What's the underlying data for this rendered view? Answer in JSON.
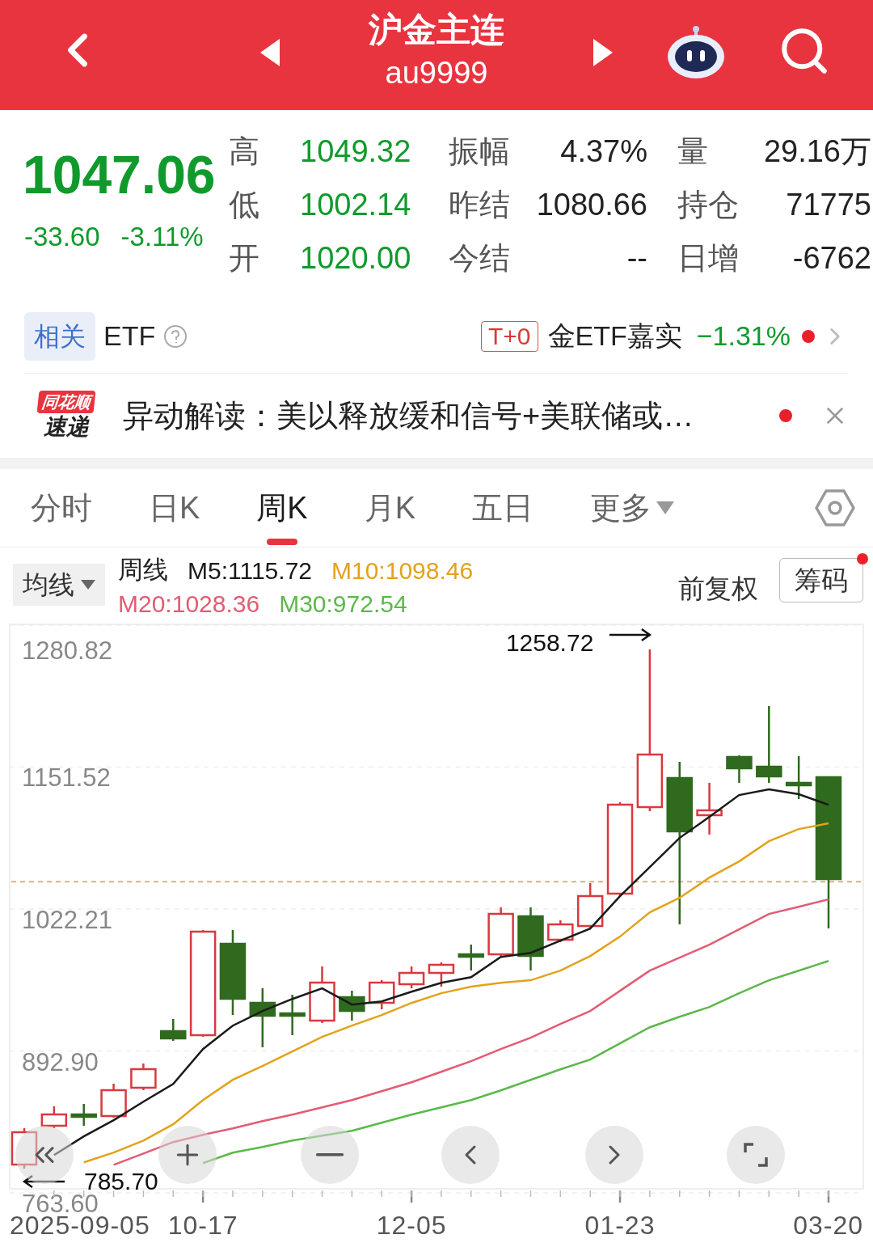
{
  "header": {
    "title": "沪金主连",
    "code": "au9999"
  },
  "quote": {
    "price": "1047.06",
    "change": "-33.60",
    "change_pct": "-3.11%",
    "color": "#109a2c",
    "stats": [
      {
        "label": "高",
        "value": "1049.32",
        "color": "#109a2c"
      },
      {
        "label": "振幅",
        "value": "4.37%",
        "color": "#222222"
      },
      {
        "label": "量",
        "value": "29.16万",
        "color": "#222222"
      },
      {
        "label": "低",
        "value": "1002.14",
        "color": "#109a2c"
      },
      {
        "label": "昨结",
        "value": "1080.66",
        "color": "#222222"
      },
      {
        "label": "持仓",
        "value": "71775",
        "color": "#222222"
      },
      {
        "label": "开",
        "value": "1020.00",
        "color": "#109a2c"
      },
      {
        "label": "今结",
        "value": "--",
        "color": "#222222"
      },
      {
        "label": "日增",
        "value": "-6762",
        "color": "#222222"
      }
    ]
  },
  "etf": {
    "tag": "相关",
    "label": "ETF",
    "badge": "T+0",
    "fund": "金ETF嘉实",
    "change": "−1.31%",
    "color": "#109a2c",
    "unread": true
  },
  "news": {
    "logo_top": "同花顺",
    "logo_bottom": "速递",
    "text": "异动解读：美以释放缓和信号+美联储或…",
    "unread": true
  },
  "period_tabs": [
    {
      "label": "分时",
      "selected": false,
      "kind": "tab"
    },
    {
      "label": "日K",
      "selected": false,
      "kind": "tab"
    },
    {
      "label": "周K",
      "selected": true,
      "kind": "tab"
    },
    {
      "label": "月K",
      "selected": false,
      "kind": "tab"
    },
    {
      "label": "五日",
      "selected": false,
      "kind": "tab"
    },
    {
      "label": "更多",
      "selected": false,
      "kind": "menu"
    }
  ],
  "indicator": {
    "dropdown": "均线",
    "period": "周线",
    "mas": [
      {
        "label": "M5:1115.72",
        "color": "#1a1a1a"
      },
      {
        "label": "M10:1098.46",
        "color": "#e3a21a"
      },
      {
        "label": "M20:1028.36",
        "color": "#e25c73"
      },
      {
        "label": "M30:972.54",
        "color": "#5cb84a"
      }
    ],
    "adjust": "前复权",
    "chips_button": "筹码",
    "chips_badge": true
  },
  "chart": {
    "start_date": "2025-09-05",
    "chart_data": {
      "type": "line",
      "grid": true,
      "categories": [
        null,
        null,
        null,
        null,
        null,
        null,
        "10-17",
        null,
        null,
        null,
        null,
        null,
        null,
        "12-05",
        null,
        null,
        null,
        null,
        null,
        null,
        "01-23",
        null,
        null,
        null,
        null,
        null,
        null,
        "03-20"
      ],
      "ylim": [
        763.6,
        1280.82
      ],
      "yticks": [
        {
          "value": 1280.82,
          "label": "1280.82"
        },
        {
          "value": 1151.52,
          "label": "1151.52"
        },
        {
          "value": 1022.21,
          "label": "1022.21"
        },
        {
          "value": 892.9,
          "label": "892.90"
        },
        {
          "value": 763.6,
          "label": "763.60"
        }
      ],
      "series": [
        {
          "color": "#1a1a1a",
          "values": [
            null,
            798.1,
            815.0,
            829.8,
            846.7,
            862.9,
            894.6,
            916.0,
            929.3,
            940.3,
            949.9,
            935.1,
            938.1,
            946.9,
            955.0,
            960.2,
            978.6,
            982.3,
            993.4,
            1004.4,
            1033.9,
            1060.4,
            1087.0,
            1106.1,
            1126.0,
            1131.2,
            1126.8,
            1117.2
          ]
        },
        {
          "color": "#e3a21a",
          "values": [
            null,
            null,
            791.4,
            800.3,
            811.3,
            826.1,
            848.2,
            866.6,
            879.1,
            892.4,
            905.7,
            916.0,
            925.6,
            936.6,
            945.5,
            951.4,
            955.0,
            957.3,
            966.1,
            979.4,
            997.1,
            1019.2,
            1032.4,
            1050.9,
            1065.6,
            1084.0,
            1095.1,
            1100.2
          ]
        },
        {
          "color": "#e25c73",
          "values": [
            null,
            null,
            null,
            789.2,
            799.5,
            809.9,
            816.5,
            822.4,
            829.0,
            834.9,
            841.5,
            848.2,
            856.3,
            864.4,
            874.0,
            883.6,
            894.6,
            904.9,
            917.5,
            929.3,
            947.7,
            966.1,
            977.9,
            989.7,
            1003.7,
            1017.7,
            1024.3,
            1031.0
          ]
        },
        {
          "color": "#5cb84a",
          "values": [
            null,
            null,
            null,
            null,
            null,
            null,
            790.7,
            800.3,
            805.4,
            811.3,
            815.8,
            820.2,
            827.5,
            834.9,
            841.5,
            848.2,
            857.0,
            866.6,
            876.2,
            885.0,
            899.8,
            914.5,
            924.1,
            932.9,
            945.5,
            957.3,
            966.1,
            974.9
          ]
        }
      ],
      "ref_lines": [
        {
          "axis": "y",
          "value": 1047.06,
          "color": "#d9b37a"
        }
      ],
      "annotations": [
        "1258.72",
        "785.70"
      ]
    }
  }
}
